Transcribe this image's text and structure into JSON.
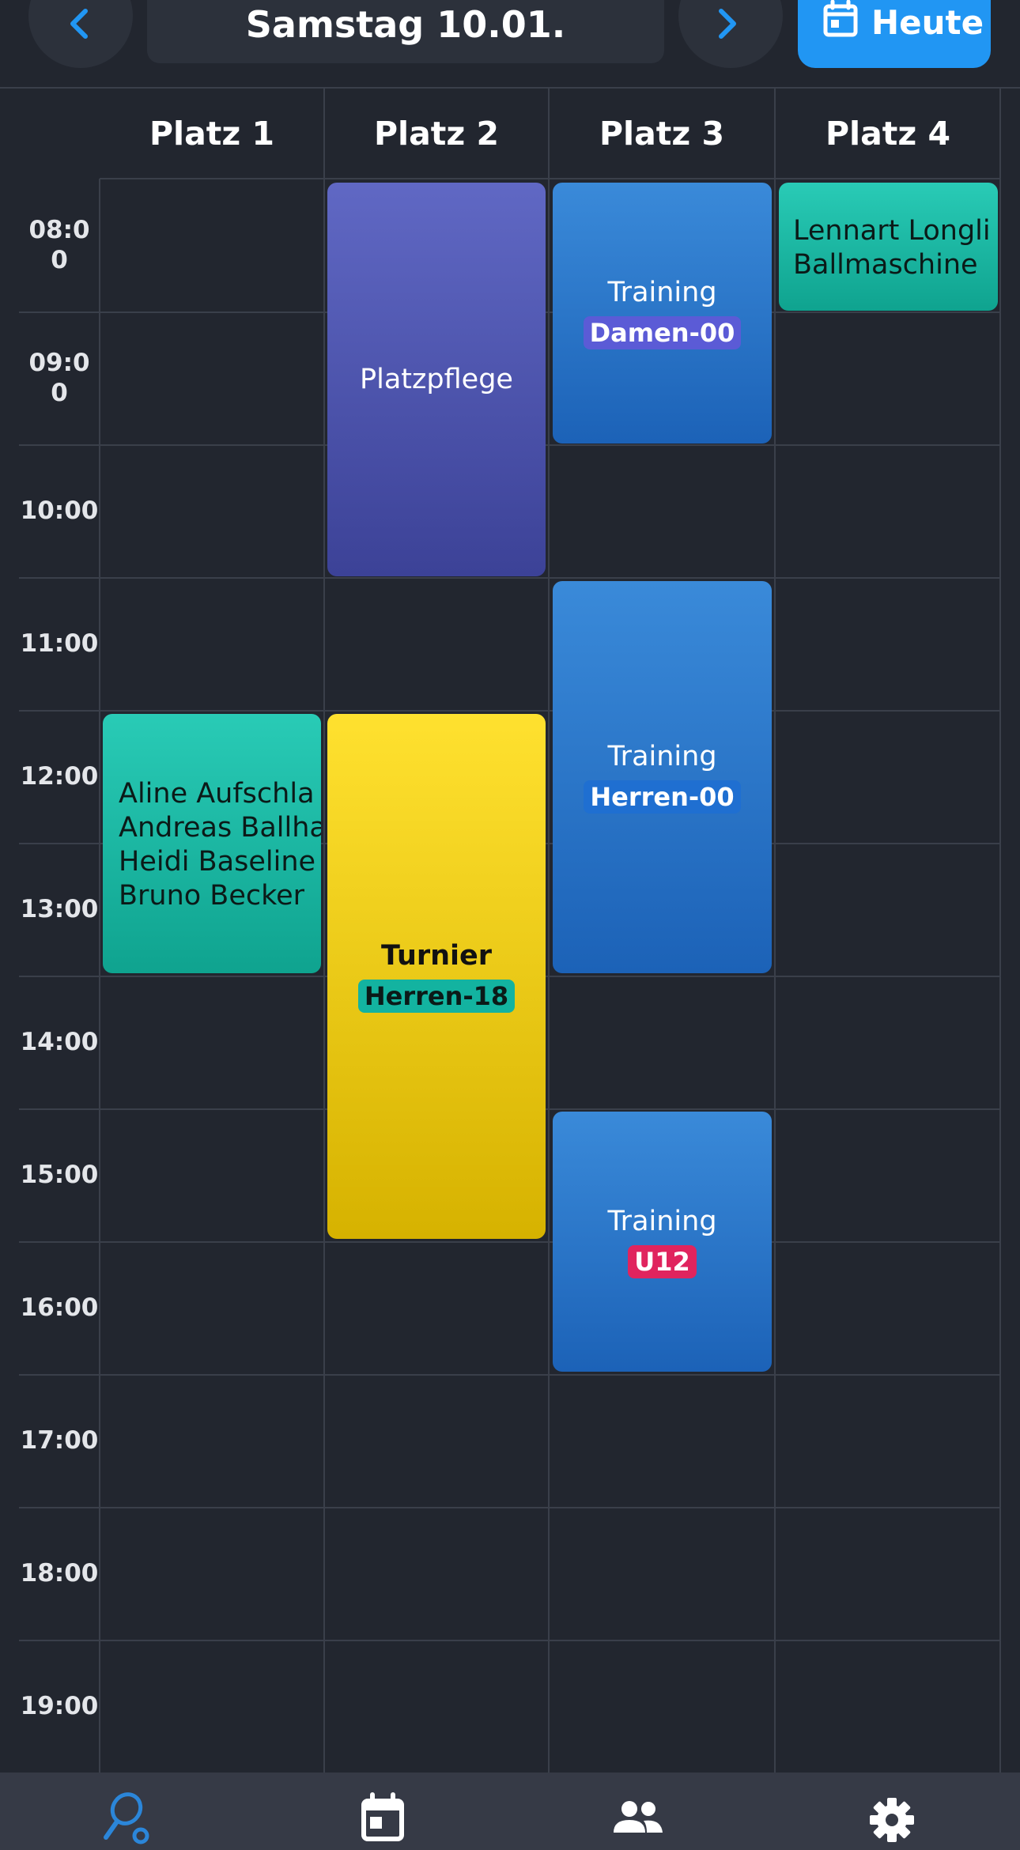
{
  "header": {
    "date": "Samstag 10.01.",
    "today_label": "Heute"
  },
  "courts": [
    "Platz 1",
    "Platz 2",
    "Platz 3",
    "Platz 4"
  ],
  "times": [
    "08:0\n0",
    "09:0\n0",
    "10:00",
    "11:00",
    "12:00",
    "13:00",
    "14:00",
    "15:00",
    "16:00",
    "17:00",
    "18:00",
    "19:00"
  ],
  "events": {
    "platz1_booking": {
      "lines": [
        "Aline Aufschla",
        "Andreas Ballha",
        "Heidi Baseline",
        "Bruno Becker"
      ]
    },
    "platz2_maintenance": {
      "title": "Platzpflege"
    },
    "platz2_tournament": {
      "title": "Turnier",
      "badge": "Herren-18"
    },
    "platz3_training1": {
      "title": "Training",
      "badge": "Damen-00"
    },
    "platz3_training2": {
      "title": "Training",
      "badge": "Herren-00"
    },
    "platz3_training3": {
      "title": "Training",
      "badge": "U12"
    },
    "platz4_booking": {
      "lines": [
        "Lennart Longli",
        "Ballmaschine"
      ]
    }
  },
  "colors": {
    "background": "#22262f",
    "accent": "#2196f3",
    "badge_damen": "#5b5bd6",
    "badge_herren": "#1f6fd1",
    "badge_u12": "#e0245e",
    "badge_turnier": "#13b3a0"
  },
  "tabs": [
    {
      "icon": "tennis-racket-icon",
      "active": true
    },
    {
      "icon": "calendar-icon",
      "active": false
    },
    {
      "icon": "people-icon",
      "active": false
    },
    {
      "icon": "gear-icon",
      "active": false
    }
  ]
}
